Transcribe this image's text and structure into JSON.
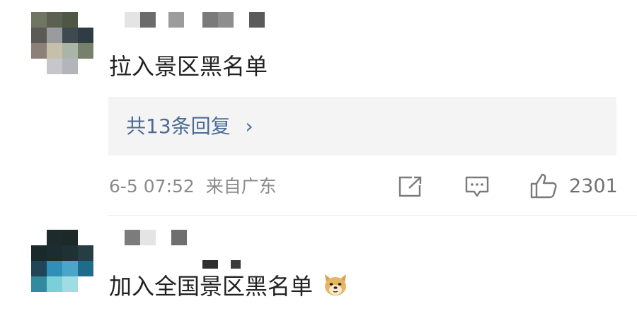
{
  "comments": [
    {
      "text": "拉入景区黑名单",
      "replies_label": "共13条回复",
      "replies_chevron": "›",
      "date": "6-5 07:52",
      "location": "来自广东",
      "share_icon": "share-icon",
      "comment_icon": "comment-icon",
      "like_icon": "thumbs-up-icon",
      "like_count": "2301"
    },
    {
      "text": "加入全国景区黑名单",
      "emoji": "doge-emoji-icon"
    }
  ],
  "colors": {
    "link": "#4b6b95",
    "meta": "#8a8a8a",
    "reply_bg": "#f4f4f5"
  }
}
